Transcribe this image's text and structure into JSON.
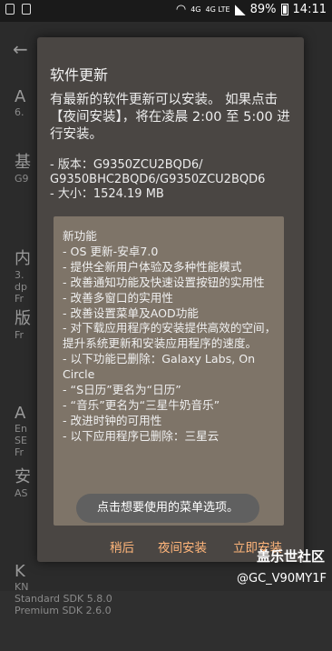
{
  "status_bar": {
    "network_top": "4G",
    "network_bottom": "4G LTE",
    "battery": "89%",
    "time": "14:11"
  },
  "background": {
    "items": [
      {
        "big": "A",
        "sub": "6."
      },
      {
        "big": "基",
        "sub": "G9"
      },
      {
        "big": "内",
        "sub": "3.\ndp\nFr"
      },
      {
        "big": "版",
        "sub": "Fr"
      },
      {
        "big": "A",
        "sub": "En\nSE\nFr"
      },
      {
        "big": "安",
        "sub": "AS"
      },
      {
        "big": "K",
        "sub": "KN\nStandard SDK 5.8.0\nPremium SDK 2.6.0"
      }
    ]
  },
  "dialog": {
    "title": "软件更新",
    "message": "有最新的软件更新可以安装。 如果点击【夜间安装】，将在凌晨 2:00 至 5:00 进行安装。",
    "version_label": " - 版本：G9350ZCU2BQD6/",
    "version_line2": "G9350BHC2BQD6/G9350ZCU2BQD6",
    "size_label": " - 大小：1524.19 MB",
    "notes_title": "新功能",
    "notes": [
      "- OS 更新-安卓7.0",
      "- 提供全新用户体验及多种性能模式",
      "- 改善通知功能及快速设置按钮的实用性",
      "- 改善多窗口的实用性",
      "- 改善设置菜单及AOD功能",
      "- 对下载应用程序的安装提供高效的空间，提升系统更新和安装应用程序的速度。",
      "- 以下功能已删除：Galaxy Labs, On Circle",
      "- “S日历”更名为“日历”",
      "- “音乐”更名为“三星牛奶音乐”",
      "- 改进时钟的可用性",
      "- 以下应用程序已删除：三星云"
    ],
    "buttons": {
      "later": "稍后",
      "night": "夜间安装",
      "now": "立即安装"
    }
  },
  "toast": "点击想要使用的菜单选项。",
  "watermark": {
    "logo": "盖乐世社区",
    "user": "@GC_V90MY1F"
  }
}
